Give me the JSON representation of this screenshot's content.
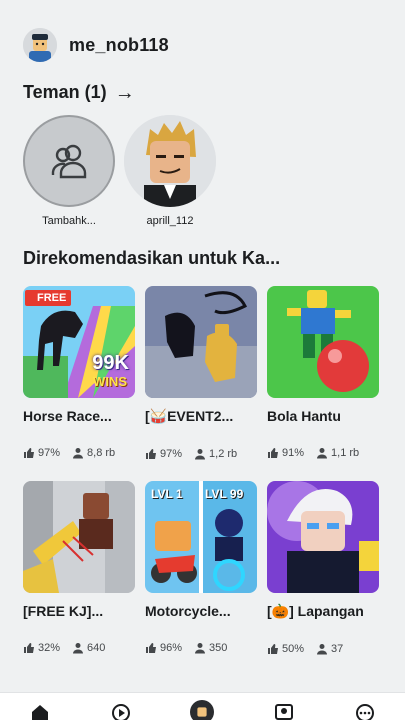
{
  "header": {
    "username": "me_nob118"
  },
  "friends": {
    "title": "Teman (1)",
    "items": [
      {
        "name": "Tambahk..."
      },
      {
        "name": "aprill_112"
      }
    ]
  },
  "recommended": {
    "title": "Direkomendasikan untuk Ka...",
    "games": [
      {
        "title": "Horse Race...",
        "rating": "97%",
        "players": "8,8 rb",
        "thumb_text_1": "FREE",
        "thumb_text_2": "99K",
        "thumb_text_3": "WINS"
      },
      {
        "title": "[🥁EVENT2...",
        "rating": "97%",
        "players": "1,2 rb"
      },
      {
        "title": "Bola Hantu",
        "rating": "91%",
        "players": "1,1 rb"
      },
      {
        "title": "[FREE KJ]...",
        "rating": "32%",
        "players": "640"
      },
      {
        "title": "Motorcycle...",
        "rating": "96%",
        "players": "350",
        "thumb_text_1": "LVL 1",
        "thumb_text_2": "LVL 99"
      },
      {
        "title": "[🎃] Lapangan",
        "rating": "50%",
        "players": "37"
      }
    ]
  },
  "tabs": [
    "home-icon",
    "play-icon",
    "avatar",
    "people-icon",
    "more-icon"
  ]
}
